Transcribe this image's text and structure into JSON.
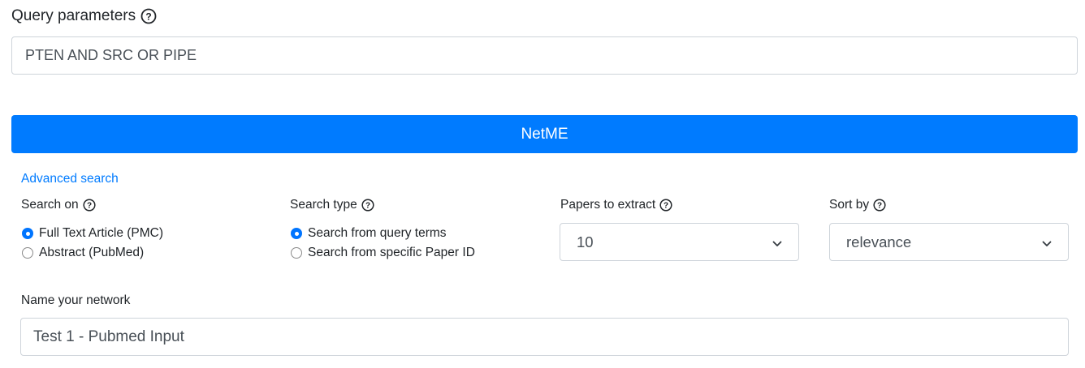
{
  "query": {
    "label": "Query parameters",
    "value": "PTEN AND SRC OR PIPE"
  },
  "primary_button": {
    "label": "NetME"
  },
  "advanced_link": "Advanced search",
  "search_on": {
    "label": "Search on",
    "options": [
      {
        "label": "Full Text Article (PMC)",
        "checked": true
      },
      {
        "label": "Abstract (PubMed)",
        "checked": false
      }
    ]
  },
  "search_type": {
    "label": "Search type",
    "options": [
      {
        "label": "Search from query terms",
        "checked": true
      },
      {
        "label": "Search from specific Paper ID",
        "checked": false
      }
    ]
  },
  "papers_to_extract": {
    "label": "Papers to extract",
    "value": "10"
  },
  "sort_by": {
    "label": "Sort by",
    "value": "relevance"
  },
  "network_name": {
    "label": "Name your network",
    "value": "Test 1 - Pubmed Input"
  },
  "colors": {
    "accent": "#007bff",
    "radio_checked": "#0075ff",
    "border": "#ced4da"
  }
}
